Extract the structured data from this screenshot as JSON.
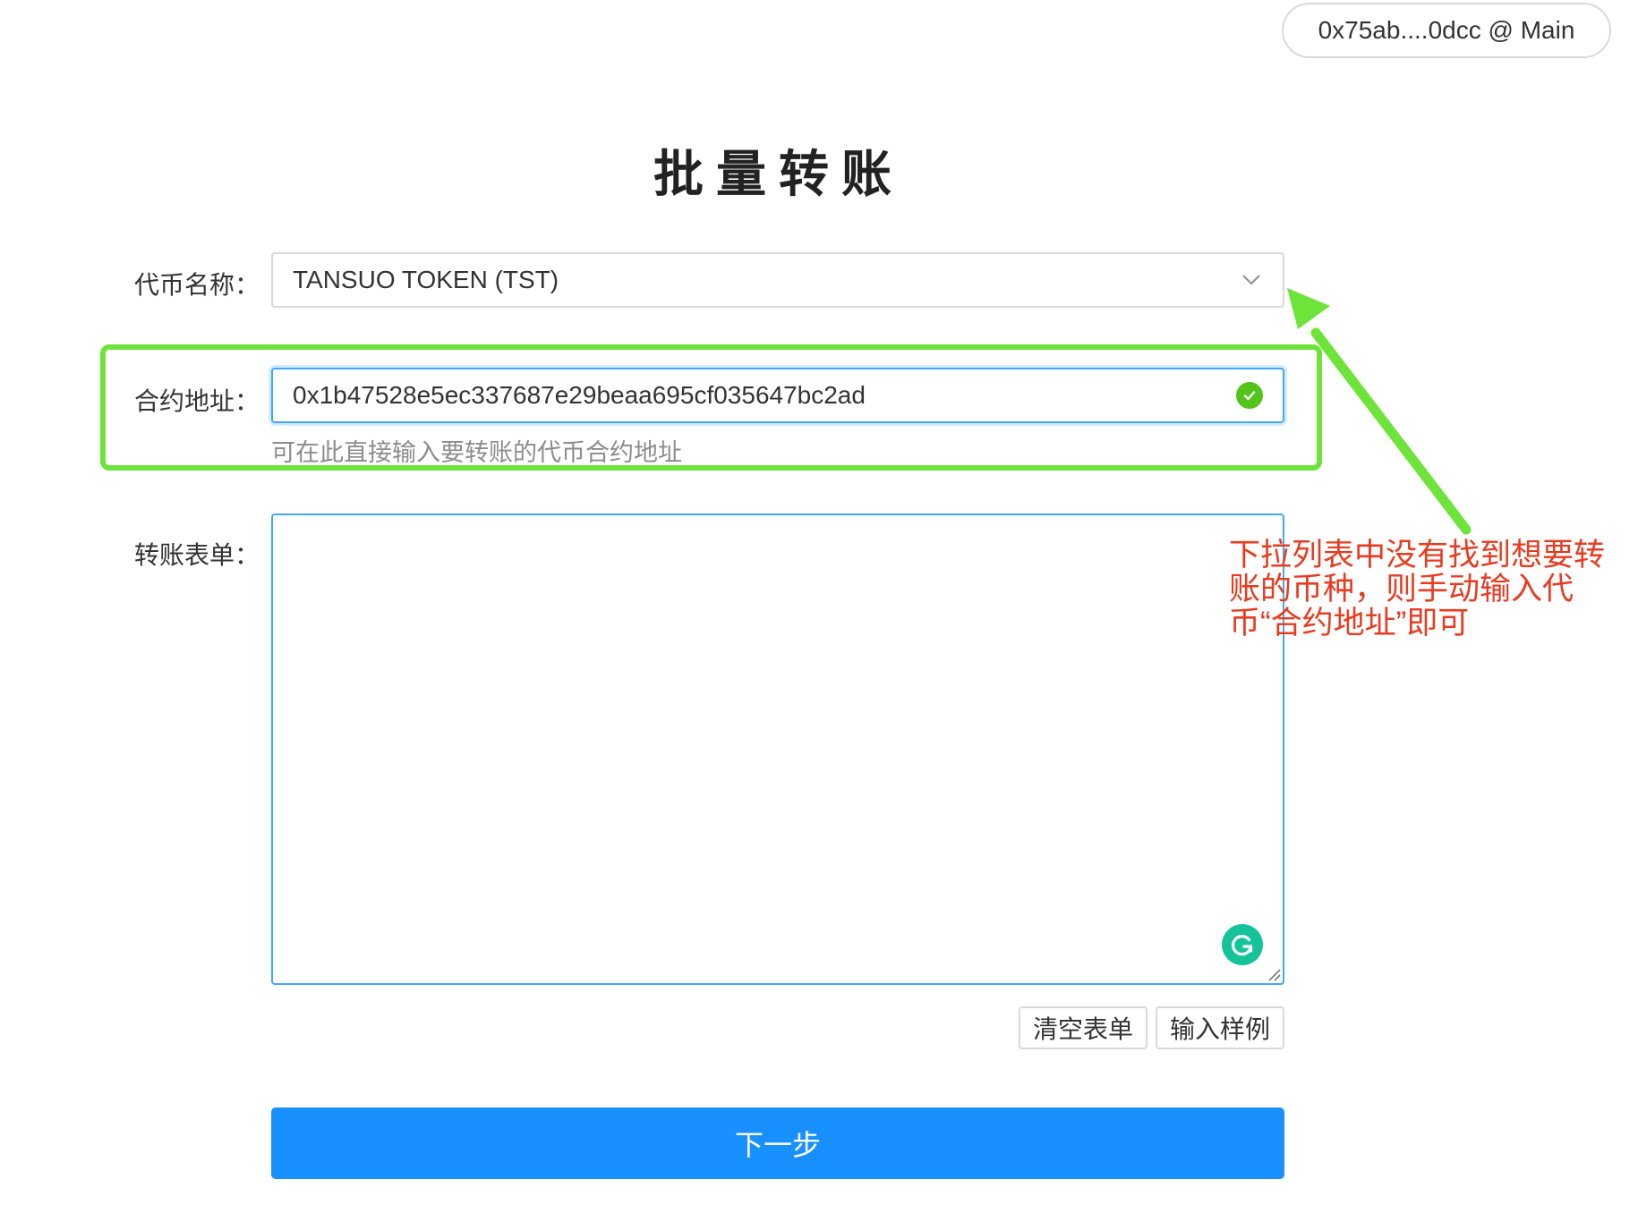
{
  "header": {
    "account": "0x75ab....0dcc @ Main"
  },
  "page": {
    "title": "批量转账"
  },
  "form": {
    "token_label": "代币名称：",
    "token_value": "TANSUO TOKEN (TST)",
    "address_label": "合约地址：",
    "address_value": "0x1b47528e5ec337687e29beaa695cf035647bc2ad",
    "address_help": "可在此直接输入要转账的代币合约地址",
    "transfer_label": "转账表单：",
    "transfer_value": "",
    "clear_button": "清空表单",
    "sample_button": "输入样例",
    "next_button": "下一步"
  },
  "annotation": {
    "text": "下拉列表中没有找到想要转账的币种，则手动输入代币“合约地址”即可"
  },
  "icons": {
    "dropdown": "chevron-down-icon",
    "valid": "check-circle-icon",
    "grammarly": "grammarly-icon",
    "resize": "resize-handle-icon"
  },
  "colors": {
    "primary": "#1890ff",
    "success": "#52c41a",
    "highlight": "#6ee33a",
    "annotation": "#e83b1f"
  }
}
